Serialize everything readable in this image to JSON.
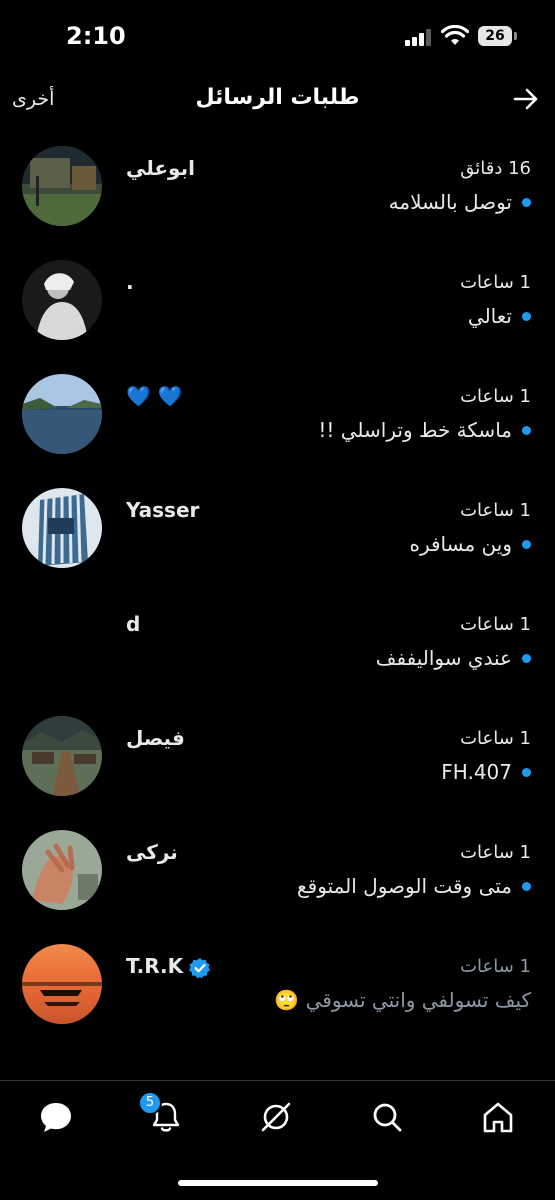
{
  "status_bar": {
    "time": "2:10",
    "battery": "26"
  },
  "header": {
    "title": "طلبات الرسائل",
    "other_label": "أخرى"
  },
  "requests": [
    {
      "name": "ابوعلي",
      "time": "16 دقائق",
      "message": "توصل بالسلامه",
      "unread": true
    },
    {
      "name": ".",
      "time": "1 ساعات",
      "message": "تعالي",
      "unread": true
    },
    {
      "name": "💙 💙",
      "time": "1 ساعات",
      "message": "ماسكة خط وتراسلي !!",
      "unread": true
    },
    {
      "name": "Yasser",
      "time": "1 ساعات",
      "message": "وين مسافره",
      "unread": true
    },
    {
      "name": "d",
      "time": "1 ساعات",
      "message": "عندي سواليففف",
      "unread": true
    },
    {
      "name": "فيصل",
      "time": "1 ساعات",
      "message": "FH.407",
      "unread": true
    },
    {
      "name": "نركى",
      "time": "1 ساعات",
      "message": "متى وقت الوصول المتوقع",
      "unread": true
    },
    {
      "name": "T.R.K",
      "time": "1 ساعات",
      "message": "كيف تسولفي وانتي تسوقي 🙄",
      "unread": false,
      "verified": true
    }
  ],
  "nav": {
    "notifications_badge": "5"
  },
  "colors": {
    "accent": "#1d9bf0",
    "background": "#000000",
    "muted": "#8b98a5"
  }
}
